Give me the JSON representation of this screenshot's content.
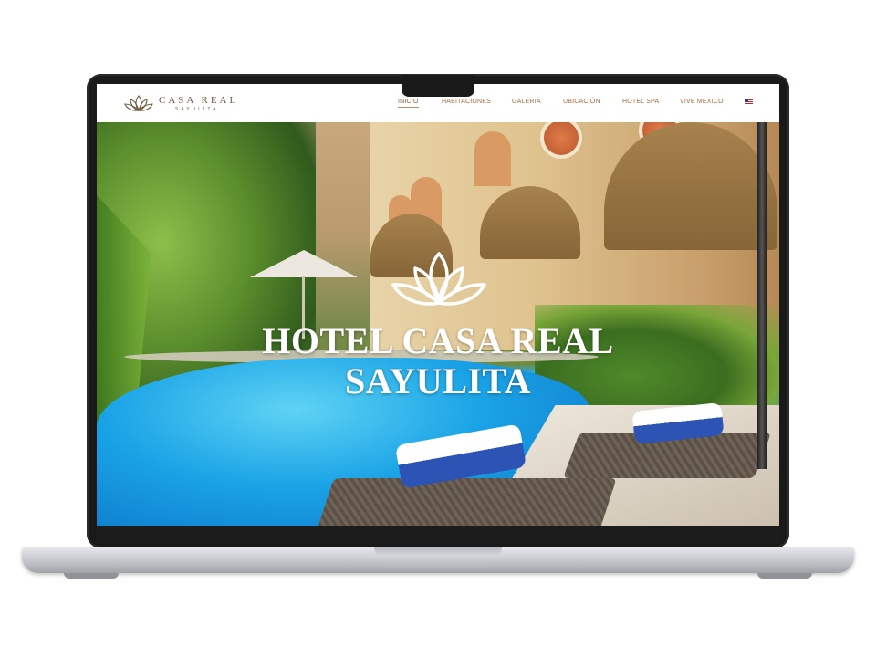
{
  "brand": {
    "name": "CASA REAL",
    "tagline": "SAYULITA",
    "accent_color": "#a9673f",
    "logo_icon": "lotus-icon"
  },
  "nav": {
    "items": [
      {
        "label": "INICIO",
        "active": true
      },
      {
        "label": "HABITACIONES",
        "active": false
      },
      {
        "label": "GALERIA",
        "active": false
      },
      {
        "label": "UBICACIÓN",
        "active": false
      },
      {
        "label": "HOTEL SPA",
        "active": false
      },
      {
        "label": "VIVE MEXICO",
        "active": false
      }
    ],
    "language_icon": "us-flag-icon"
  },
  "hero": {
    "title_line1": "HOTEL CASA REAL",
    "title_line2": "SAYULITA",
    "icon": "lotus-icon"
  }
}
